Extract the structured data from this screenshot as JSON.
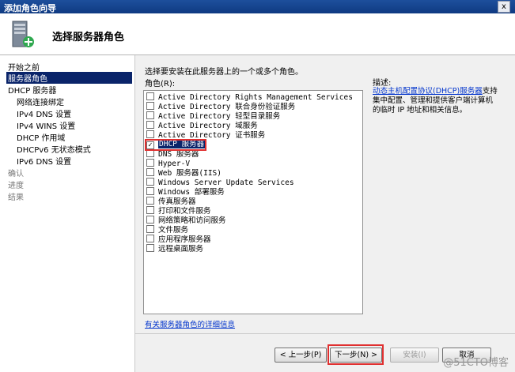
{
  "window": {
    "title": "添加角色向导",
    "close": "x"
  },
  "header": {
    "title": "选择服务器角色"
  },
  "nav": {
    "items": [
      {
        "label": "开始之前",
        "state": "normal"
      },
      {
        "label": "服务器角色",
        "state": "selected"
      },
      {
        "label": "DHCP 服务器",
        "state": "normal"
      },
      {
        "label": "网络连接绑定",
        "state": "sub"
      },
      {
        "label": "IPv4 DNS 设置",
        "state": "sub"
      },
      {
        "label": "IPv4 WINS 设置",
        "state": "sub"
      },
      {
        "label": "DHCP 作用域",
        "state": "sub"
      },
      {
        "label": "DHCPv6 无状态模式",
        "state": "sub"
      },
      {
        "label": "IPv6 DNS 设置",
        "state": "sub"
      },
      {
        "label": "确认",
        "state": "dim"
      },
      {
        "label": "进度",
        "state": "dim"
      },
      {
        "label": "结果",
        "state": "dim"
      }
    ]
  },
  "main": {
    "instruction": "选择要安装在此服务器上的一个或多个角色。",
    "roles_label": "角色(R):",
    "roles": [
      {
        "label": "Active Directory Rights Management Services",
        "checked": false
      },
      {
        "label": "Active Directory 联合身份验证服务",
        "checked": false
      },
      {
        "label": "Active Directory 轻型目录服务",
        "checked": false
      },
      {
        "label": "Active Directory 域服务",
        "checked": false
      },
      {
        "label": "Active Directory 证书服务",
        "checked": false
      },
      {
        "label": "DHCP 服务器",
        "checked": true
      },
      {
        "label": "DNS 服务器",
        "checked": false
      },
      {
        "label": "Hyper-V",
        "checked": false
      },
      {
        "label": "Web 服务器(IIS)",
        "checked": false
      },
      {
        "label": "Windows Server Update Services",
        "checked": false
      },
      {
        "label": "Windows 部署服务",
        "checked": false
      },
      {
        "label": "传真服务器",
        "checked": false
      },
      {
        "label": "打印和文件服务",
        "checked": false
      },
      {
        "label": "网络策略和访问服务",
        "checked": false
      },
      {
        "label": "文件服务",
        "checked": false
      },
      {
        "label": "应用程序服务器",
        "checked": false
      },
      {
        "label": "远程桌面服务",
        "checked": false
      }
    ],
    "description_label": "描述:",
    "description_link": "动态主机配置协议(DHCP)服务器",
    "description_text": "支持集中配置、管理和提供客户端计算机的临时 IP 地址和相关信息。",
    "more_info_link": "有关服务器角色的详细信息"
  },
  "buttons": {
    "back": "< 上一步(P)",
    "next": "下一步(N) >",
    "install": "安装(I)",
    "cancel": "取消"
  },
  "watermark": "@51CTO博客"
}
